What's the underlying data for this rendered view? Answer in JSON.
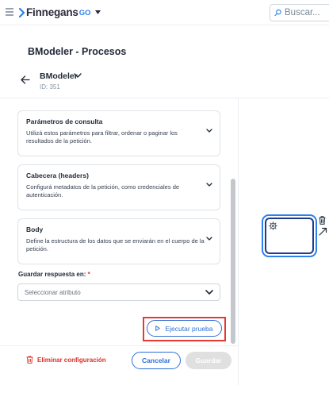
{
  "app": {
    "logo_text": "Finnegans",
    "logo_suffix": "GO",
    "brand_color": "#2f80ed"
  },
  "search": {
    "placeholder": "Buscar..."
  },
  "page": {
    "title": "BModeler - Procesos"
  },
  "module": {
    "name": "BModeler",
    "id_label": "ID: 351"
  },
  "cards": [
    {
      "title": "Parámetros de consulta",
      "description": "Utilizá estos parámetros para filtrar, ordenar o paginar los resultados de la petición."
    },
    {
      "title": "Cabecera (headers)",
      "description": "Configurá metadatos de la petición, como credenciales de autenticación."
    },
    {
      "title": "Body",
      "description": "Define la estructura de los datos que se enviarán en el cuerpo de la petición."
    }
  ],
  "response_field": {
    "label": "Guardar respuesta en:",
    "required_mark": "*",
    "placeholder": "Seleccionar atributo"
  },
  "actions": {
    "execute_label": "Ejecutar prueba",
    "delete_label": "Eliminar configuración",
    "cancel_label": "Cancelar",
    "save_label": "Guardar"
  },
  "colors": {
    "primary": "#2f6fd6",
    "danger": "#d93025",
    "highlight": "#e53935",
    "disabled": "#e0e0e0"
  }
}
